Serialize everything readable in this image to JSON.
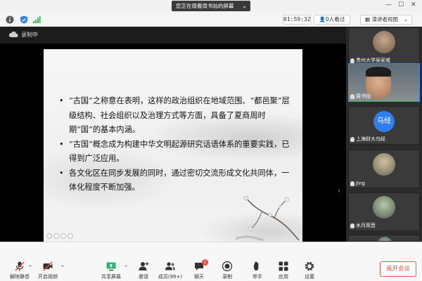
{
  "share_banner": {
    "text": "您正在观看周书灿的屏幕"
  },
  "infobar": {
    "timer": "01:59:32",
    "watching": "0人看过",
    "speaker_view": "演讲者视图"
  },
  "recording": {
    "label": "录制中"
  },
  "slide": {
    "bullets": [
      "“古国”之称意在表明，这样的政治组织在地域范围、“都邑聚”层级结构、社会组织以及治理方式等方面，具备了夏商周时期“国”的基本内涵。",
      "“古国”概念成为构建中华文明起源研究话语体系的重要实践，已得到广泛应用。",
      "各文化区在同步发展的同时，通过密切交流形成文化共同体，一体化程度不断加强。"
    ]
  },
  "participants": [
    {
      "name": "贵州大学吴家威",
      "type": "avatar"
    },
    {
      "name": "周书灿",
      "type": "video",
      "active": true
    },
    {
      "name": "上海财大乌经",
      "type": "initials",
      "initials": "乌经"
    },
    {
      "name": "Jing",
      "type": "avatar"
    },
    {
      "name": "水月观音",
      "type": "avatar"
    },
    {
      "name": "",
      "type": "avatar"
    }
  ],
  "toolbar": {
    "unmute": "解除静音",
    "start_video": "开启视频",
    "share_screen": "共享屏幕",
    "invite": "邀请",
    "members": "成员(99+)",
    "chat": "聊天",
    "chat_badge": "1",
    "record": "录制",
    "raise_hand": "举手",
    "apps": "应用",
    "settings": "设置",
    "leave": "离开会议"
  },
  "colors": {
    "accent_blue": "#2f7ef0",
    "leave_red": "#e85a4f",
    "active_border": "#2f8cff"
  }
}
